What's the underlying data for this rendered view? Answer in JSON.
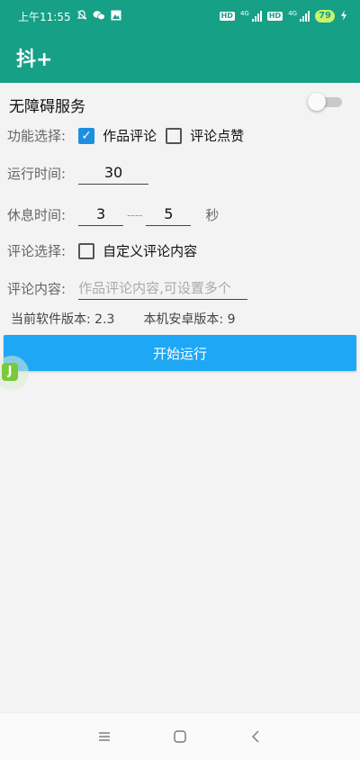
{
  "status_bar": {
    "time": "上午11:55",
    "left_icons": [
      "bell-off-icon",
      "wechat-icon",
      "image-icon"
    ],
    "network_1": "4G",
    "network_2": "4G",
    "hd_label": "HD",
    "battery": "79"
  },
  "app_bar": {
    "title": "抖+"
  },
  "accessibility": {
    "label": "无障碍服务",
    "enabled": false
  },
  "function_select": {
    "label": "功能选择:",
    "options": [
      {
        "label": "作品评论",
        "checked": true
      },
      {
        "label": "评论点赞",
        "checked": false
      }
    ]
  },
  "run_time": {
    "label": "运行时间:",
    "value": "30"
  },
  "rest_time": {
    "label": "休息时间:",
    "min": "3",
    "separator": "----",
    "max": "5",
    "unit": "秒"
  },
  "comment_select": {
    "label": "评论选择:",
    "option": {
      "label": "自定义评论内容",
      "checked": false
    }
  },
  "comment_content": {
    "label": "评论内容:",
    "placeholder": "作品评论内容,可设置多个"
  },
  "version": {
    "software_label": "当前软件版本: 2.3",
    "android_label": "本机安卓版本: 9"
  },
  "start_button": {
    "label": "开始运行"
  },
  "floating_icon": {
    "glyph": "J"
  },
  "colors": {
    "primary": "#16a085",
    "accent": "#1ea7f5",
    "checkbox": "#1e8fe0"
  }
}
